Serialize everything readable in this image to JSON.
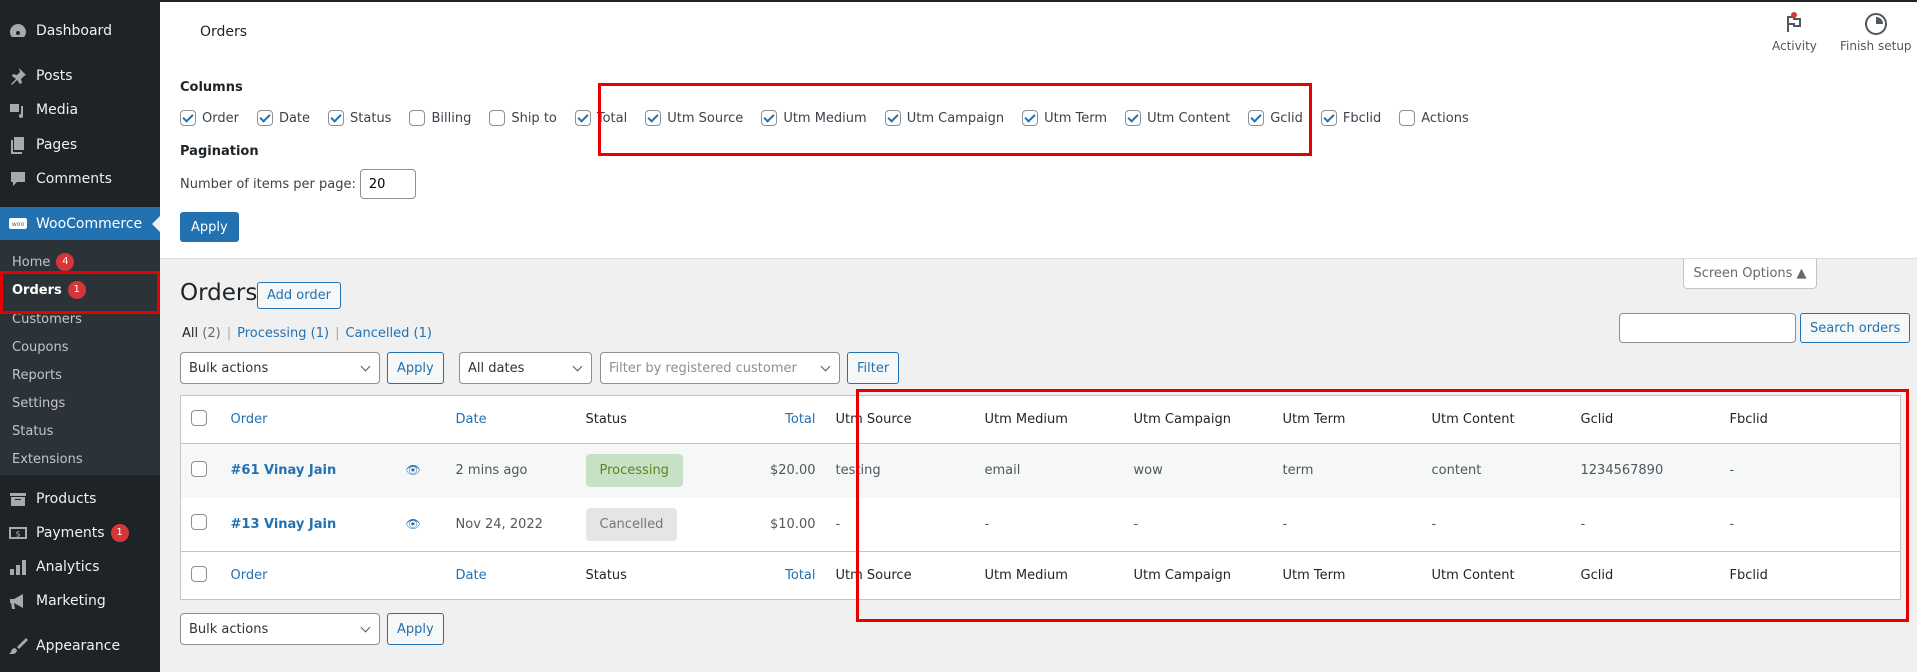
{
  "sidebar": {
    "items": [
      {
        "label": "Dashboard",
        "icon": "dashboard-icon"
      },
      {
        "label": "Posts",
        "icon": "pin-icon"
      },
      {
        "label": "Media",
        "icon": "media-icon"
      },
      {
        "label": "Pages",
        "icon": "pages-icon"
      },
      {
        "label": "Comments",
        "icon": "comment-icon"
      },
      {
        "label": "WooCommerce",
        "icon": "woo-icon"
      },
      {
        "label": "Products",
        "icon": "archive-icon"
      },
      {
        "label": "Payments",
        "icon": "dollar-icon",
        "badge": "1"
      },
      {
        "label": "Analytics",
        "icon": "bar-chart-icon"
      },
      {
        "label": "Marketing",
        "icon": "megaphone-icon"
      },
      {
        "label": "Appearance",
        "icon": "paintbrush-icon"
      }
    ],
    "submenu": [
      {
        "label": "Home",
        "badge": "4"
      },
      {
        "label": "Orders",
        "badge": "1"
      },
      {
        "label": "Customers"
      },
      {
        "label": "Coupons"
      },
      {
        "label": "Reports"
      },
      {
        "label": "Settings"
      },
      {
        "label": "Status"
      },
      {
        "label": "Extensions"
      }
    ]
  },
  "header": {
    "title": "Orders",
    "activity_label": "Activity",
    "finish_setup_label": "Finish setup"
  },
  "screen_options": {
    "columns_legend": "Columns",
    "columns": [
      {
        "label": "Order",
        "checked": true
      },
      {
        "label": "Date",
        "checked": true
      },
      {
        "label": "Status",
        "checked": true
      },
      {
        "label": "Billing",
        "checked": false
      },
      {
        "label": "Ship to",
        "checked": false
      },
      {
        "label": "Total",
        "checked": true
      },
      {
        "label": "Utm Source",
        "checked": true
      },
      {
        "label": "Utm Medium",
        "checked": true
      },
      {
        "label": "Utm Campaign",
        "checked": true
      },
      {
        "label": "Utm Term",
        "checked": true
      },
      {
        "label": "Utm Content",
        "checked": true
      },
      {
        "label": "Gclid",
        "checked": true
      },
      {
        "label": "Fbclid",
        "checked": true
      },
      {
        "label": "Actions",
        "checked": false
      }
    ],
    "pagination_legend": "Pagination",
    "per_page_label": "Number of items per page:",
    "per_page_value": "20",
    "apply_label": "Apply",
    "tab_label": "Screen Options ▲"
  },
  "orders_page": {
    "title": "Orders",
    "add_order_label": "Add order",
    "views": [
      {
        "label": "All",
        "count": "(2)",
        "current": true
      },
      {
        "label": "Processing",
        "count": "(1)"
      },
      {
        "label": "Cancelled",
        "count": "(1)"
      }
    ],
    "bulk_actions_label": "Bulk actions",
    "apply_label": "Apply",
    "dates_label": "All dates",
    "customer_placeholder": "Filter by registered customer",
    "filter_label": "Filter",
    "search_value": "",
    "search_button_label": "Search orders"
  },
  "table": {
    "columns": [
      "Order",
      "Date",
      "Status",
      "Total",
      "Utm Source",
      "Utm Medium",
      "Utm Campaign",
      "Utm Term",
      "Utm Content",
      "Gclid",
      "Fbclid"
    ],
    "rows": [
      {
        "order": "#61 Vinay Jain",
        "date": "2 mins ago",
        "status": "Processing",
        "total": "$20.00",
        "utm_source": "testing",
        "utm_medium": "email",
        "utm_campaign": "wow",
        "utm_term": "term",
        "utm_content": "content",
        "gclid": "1234567890",
        "fbclid": "-"
      },
      {
        "order": "#13 Vinay Jain",
        "date": "Nov 24, 2022",
        "status": "Cancelled",
        "total": "$10.00",
        "utm_source": "-",
        "utm_medium": "-",
        "utm_campaign": "-",
        "utm_term": "-",
        "utm_content": "-",
        "gclid": "-",
        "fbclid": "-"
      }
    ]
  },
  "colors": {
    "accent": "#2271b1",
    "sidebar_bg": "#1d2327",
    "highlight_box": "#e60000",
    "processing_bg": "#c6e1c6",
    "cancelled_bg": "#e5e5e5"
  }
}
